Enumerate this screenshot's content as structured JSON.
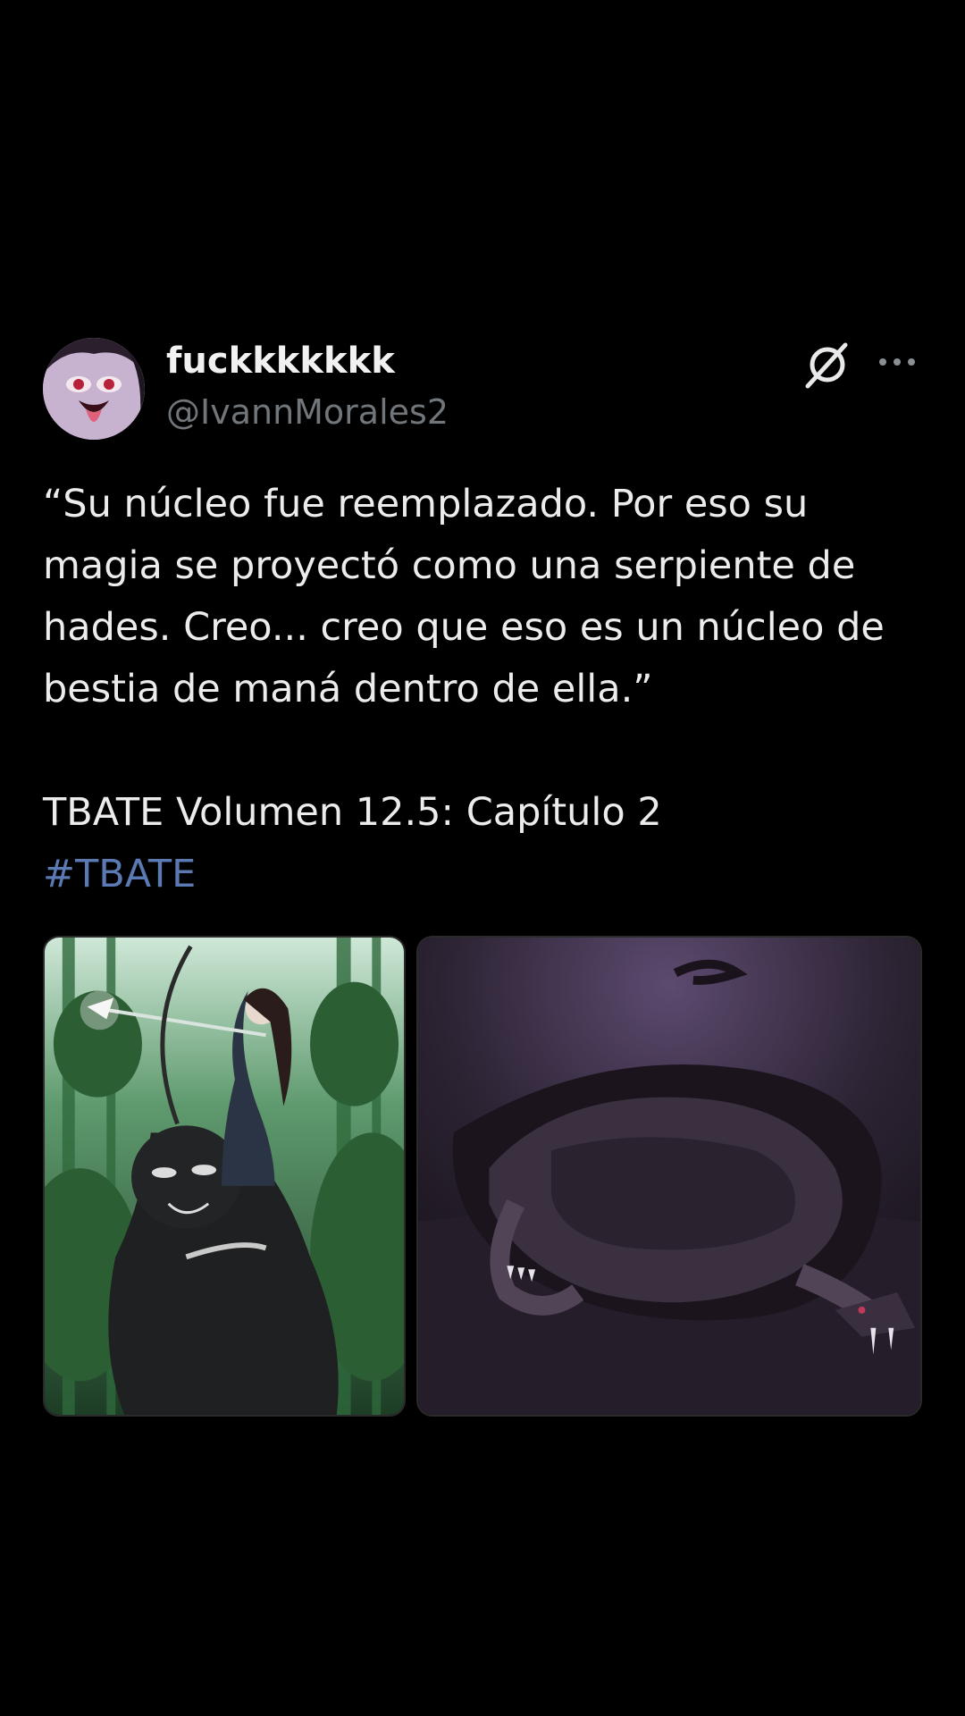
{
  "post": {
    "author": {
      "display_name": "fuckkkkkkk",
      "handle": "@IvannMorales2",
      "avatar_icon": "anime-avatar"
    },
    "icons": {
      "x_logo": "x-grok-icon",
      "more": "more-options-icon"
    },
    "text": "“Su núcleo fue reemplazado. Por eso su magia se proyectó como una serpiente de hades. Creo... creo que eso es un núcleo de bestia de maná dentro de ella.”",
    "reference": "TBATE Volumen 12.5: Capítulo 2",
    "hashtag": "#TBATE",
    "media": [
      {
        "kind": "image",
        "subject": "archer-on-bear"
      },
      {
        "kind": "image",
        "subject": "shadow-serpent"
      }
    ]
  },
  "colors": {
    "background": "#000000",
    "text": "#ececec",
    "secondary_text": "#71767b",
    "hashtag": "#5b7ab4"
  }
}
